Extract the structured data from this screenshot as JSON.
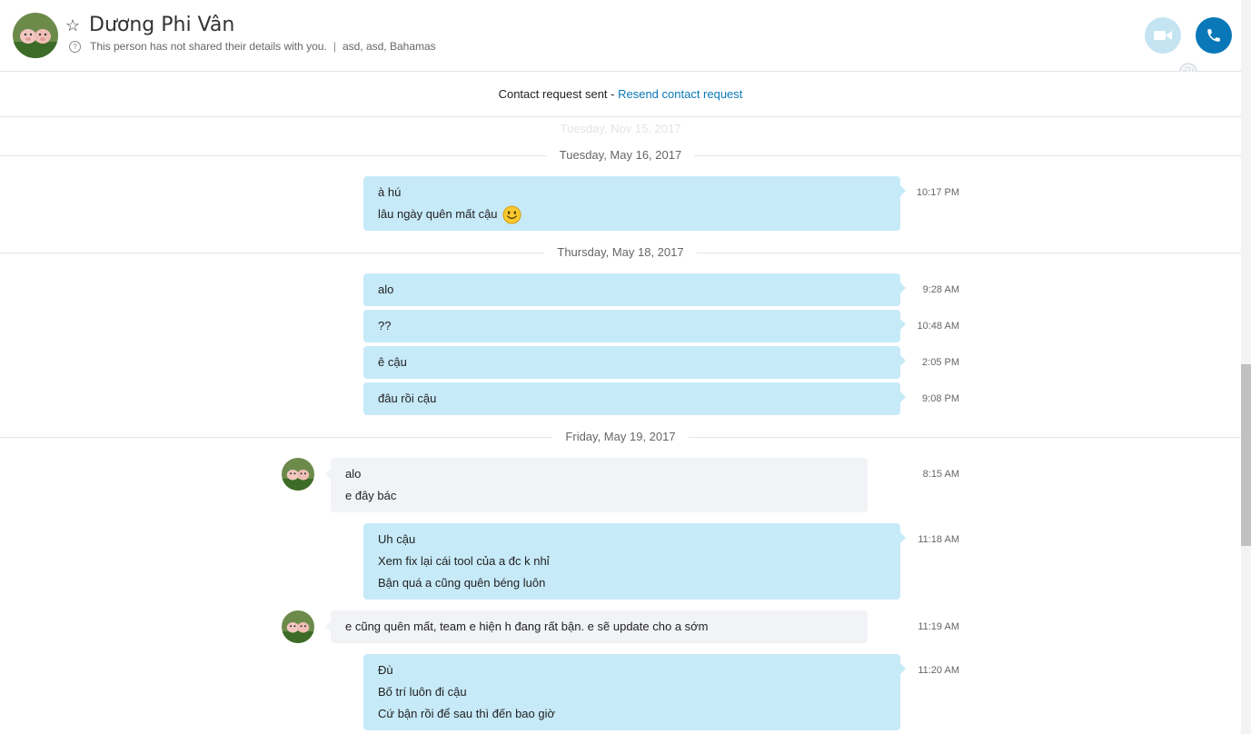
{
  "header": {
    "contact_name": "Dương Phi Vân",
    "details_text": "This person has not shared their details with you.",
    "separator": "|",
    "location": "asd, asd, Bahamas",
    "star_icon": "star-outline",
    "info_icon": "question-circle",
    "video_call_icon": "video-camera",
    "audio_call_icon": "phone",
    "status_icon": "globe"
  },
  "request_bar": {
    "text": "Contact request sent - ",
    "link": "Resend contact request"
  },
  "faded_date": "Tuesday, Nov 15, 2017",
  "conversation": [
    {
      "date": "Tuesday, May 16, 2017",
      "messages": [
        {
          "direction": "out",
          "time": "10:17 PM",
          "lines": [
            "à hú",
            "lâu ngày quên mất cậu"
          ],
          "emoticon": "smile"
        }
      ]
    },
    {
      "date": "Thursday, May 18, 2017",
      "messages": [
        {
          "direction": "out",
          "time": "9:28 AM",
          "lines": [
            "alo"
          ]
        },
        {
          "direction": "out",
          "time": "10:48 AM",
          "lines": [
            "??"
          ]
        },
        {
          "direction": "out",
          "time": "2:05 PM",
          "lines": [
            "ê cậu"
          ]
        },
        {
          "direction": "out",
          "time": "9:08 PM",
          "lines": [
            "đâu rồi cậu"
          ]
        }
      ]
    },
    {
      "date": "Friday, May 19, 2017",
      "messages": [
        {
          "direction": "in",
          "time": "8:15 AM",
          "lines": [
            "alo",
            "e đây bác"
          ]
        },
        {
          "direction": "out",
          "time": "11:18 AM",
          "lines": [
            "Uh cậu",
            "Xem fix lại cái tool của a đc k nhỉ",
            "Bận quá a cũng quên béng luôn"
          ]
        },
        {
          "direction": "in",
          "time": "11:19 AM",
          "lines": [
            "e cũng quên mất, team e hiện h đang rất bận. e sẽ update cho a sớm"
          ]
        },
        {
          "direction": "out",
          "time": "11:20 AM",
          "lines": [
            "Đù",
            "Bố trí luôn đi cậu",
            "Cứ bận rồi để sau thì đến bao giờ"
          ]
        }
      ]
    }
  ],
  "colors": {
    "outgoing_bubble": "#c7eaf9",
    "incoming_bubble": "#f1f3f6",
    "accent": "#0a78b8",
    "video_button": "#c4e4f2"
  }
}
